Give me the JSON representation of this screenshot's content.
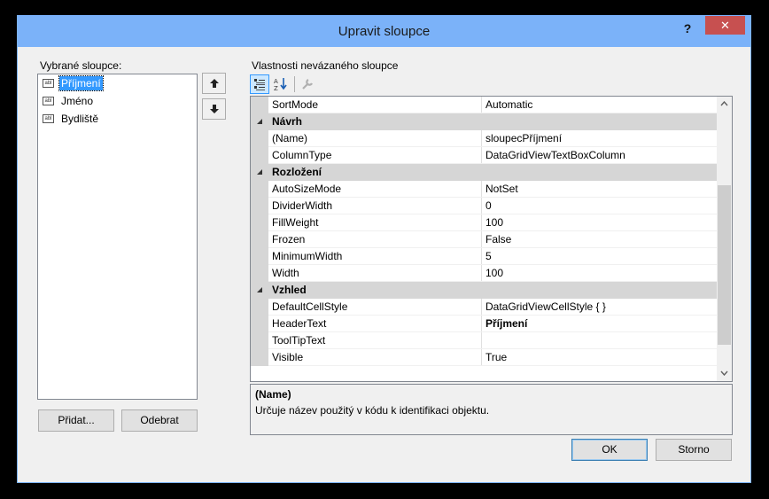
{
  "window": {
    "title": "Upravit sloupce",
    "help": "?",
    "close": "✕"
  },
  "left": {
    "label": "Vybrané sloupce:",
    "icon_text": "abl",
    "columns": [
      {
        "label": "Příjmení",
        "selected": true
      },
      {
        "label": "Jméno",
        "selected": false
      },
      {
        "label": "Bydliště",
        "selected": false
      }
    ],
    "add_label": "Přidat...",
    "remove_label": "Odebrat"
  },
  "right": {
    "label": "Vlastnosti nevázaného sloupce",
    "rows": [
      {
        "type": "prop",
        "name": "SortMode",
        "value": "Automatic"
      },
      {
        "type": "cat",
        "name": "Návrh"
      },
      {
        "type": "prop",
        "name": "(Name)",
        "value": "sloupecPříjmení"
      },
      {
        "type": "prop",
        "name": "ColumnType",
        "value": "DataGridViewTextBoxColumn"
      },
      {
        "type": "cat",
        "name": "Rozložení"
      },
      {
        "type": "prop",
        "name": "AutoSizeMode",
        "value": "NotSet"
      },
      {
        "type": "prop",
        "name": "DividerWidth",
        "value": "0"
      },
      {
        "type": "prop",
        "name": "FillWeight",
        "value": "100"
      },
      {
        "type": "prop",
        "name": "Frozen",
        "value": "False"
      },
      {
        "type": "prop",
        "name": "MinimumWidth",
        "value": "5"
      },
      {
        "type": "prop",
        "name": "Width",
        "value": "100"
      },
      {
        "type": "cat",
        "name": "Vzhled"
      },
      {
        "type": "prop",
        "name": "DefaultCellStyle",
        "value": "DataGridViewCellStyle { }"
      },
      {
        "type": "prop",
        "name": "HeaderText",
        "value": "Příjmení",
        "bold": true
      },
      {
        "type": "prop",
        "name": "ToolTipText",
        "value": ""
      },
      {
        "type": "prop",
        "name": "Visible",
        "value": "True"
      }
    ],
    "description": {
      "title": "(Name)",
      "text": "Určuje název použitý v kódu k identifikaci objektu."
    }
  },
  "buttons": {
    "ok": "OK",
    "cancel": "Storno"
  },
  "colors": {
    "titlebar": "#7bb2f9",
    "close_button": "#c75050",
    "selection": "#3399ff",
    "category_band": "#d6d6d6"
  },
  "icons": {
    "categorized": "categorized-icon",
    "alphabetical": "alphabetical-sort-icon",
    "property_pages": "wrench-icon",
    "move_up": "arrow-up-icon",
    "move_down": "arrow-down-icon"
  }
}
